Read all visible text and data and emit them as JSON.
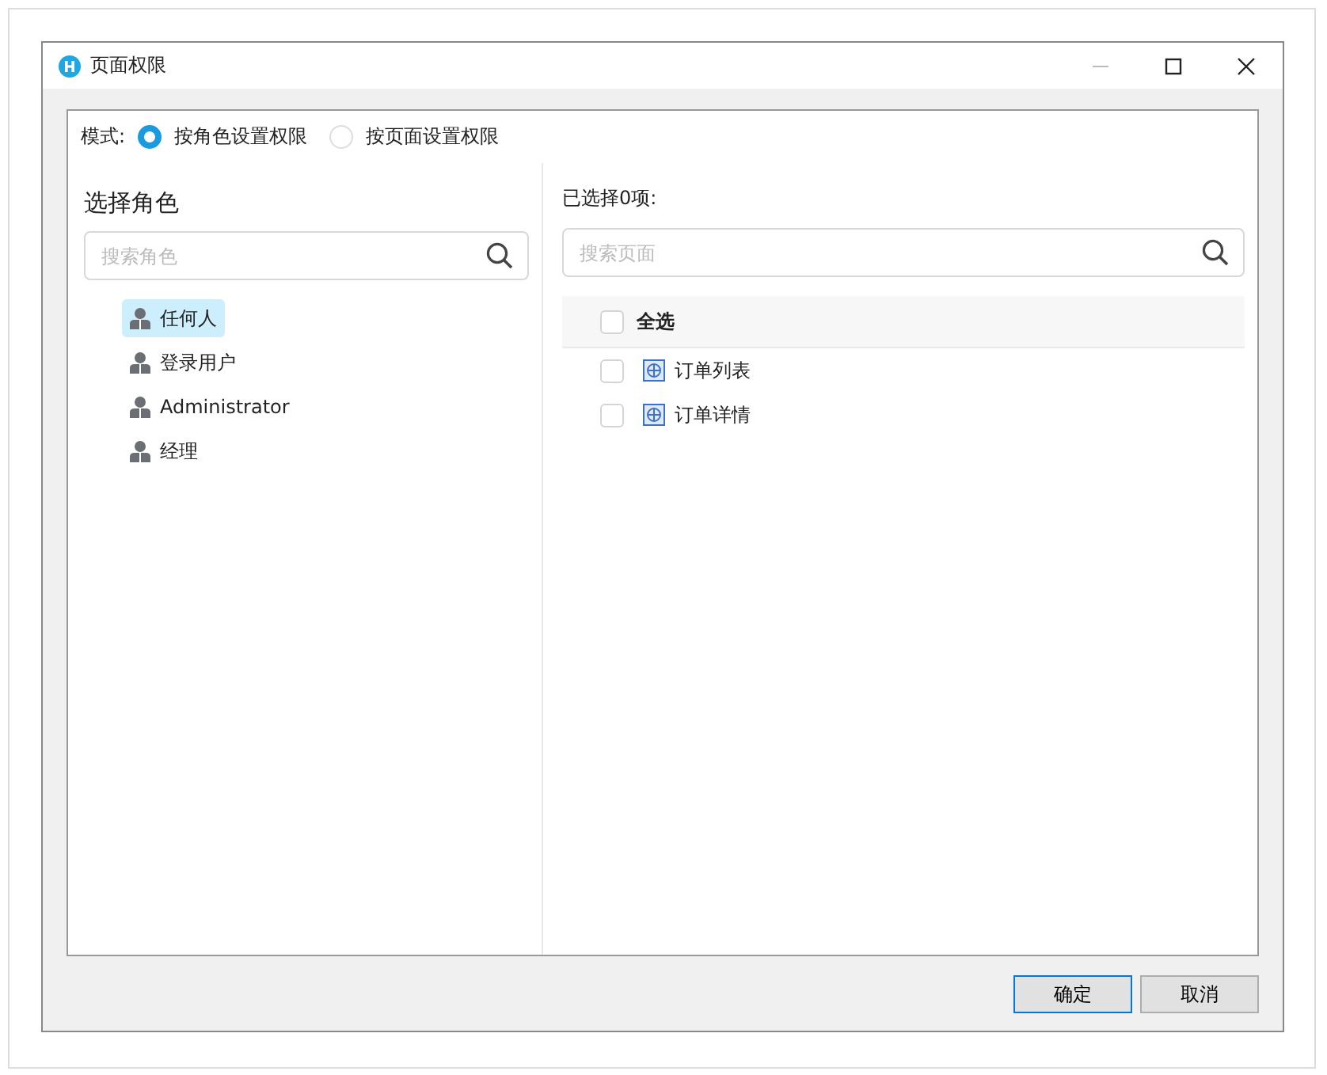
{
  "window": {
    "title": "页面权限"
  },
  "mode": {
    "label": "模式:",
    "options": [
      {
        "label": "按角色设置权限",
        "selected": true
      },
      {
        "label": "按页面设置权限",
        "selected": false
      }
    ]
  },
  "roles": {
    "title": "选择角色",
    "search": {
      "placeholder": "搜索角色"
    },
    "items": [
      {
        "label": "任何人",
        "selected": true
      },
      {
        "label": "登录用户",
        "selected": false
      },
      {
        "label": "Administrator",
        "selected": false
      },
      {
        "label": "经理",
        "selected": false
      }
    ]
  },
  "pages": {
    "summary": "已选择0项:",
    "search": {
      "placeholder": "搜索页面"
    },
    "select_all": {
      "label": "全选",
      "checked": false
    },
    "items": [
      {
        "label": "订单列表",
        "checked": false
      },
      {
        "label": "订单详情",
        "checked": false
      }
    ]
  },
  "buttons": [
    {
      "label": "确定",
      "kind": "primary"
    },
    {
      "label": "取消",
      "kind": "secondary"
    }
  ]
}
